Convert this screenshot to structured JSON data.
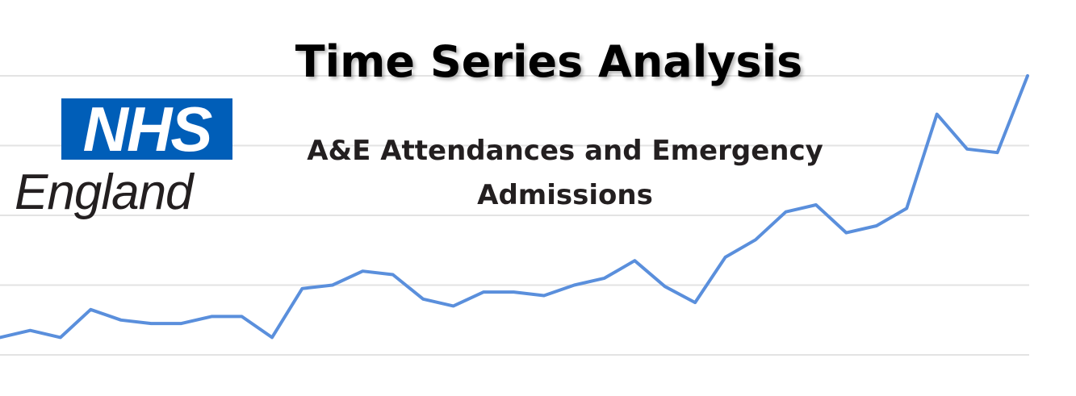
{
  "title": "Time Series Analysis",
  "subtitle": "A&E Attendances and Emergency Admissions",
  "logo": {
    "nhs_text": "NHS",
    "region_text": "England",
    "nhs_blue": "#005eb8"
  },
  "chart_data": {
    "type": "line",
    "title": "",
    "xlabel": "",
    "ylabel": "",
    "grid": true,
    "line_color": "#5a8fdc",
    "y_values": [
      0.25,
      0.35,
      0.25,
      0.65,
      0.5,
      0.45,
      0.45,
      0.55,
      0.55,
      0.25,
      0.95,
      1.0,
      1.2,
      1.15,
      0.8,
      0.7,
      0.9,
      0.9,
      0.85,
      1.0,
      1.1,
      1.35,
      0.98,
      0.75,
      1.4,
      1.65,
      2.05,
      2.15,
      1.75,
      1.85,
      2.1,
      3.45,
      2.95,
      2.9,
      4.0
    ]
  }
}
